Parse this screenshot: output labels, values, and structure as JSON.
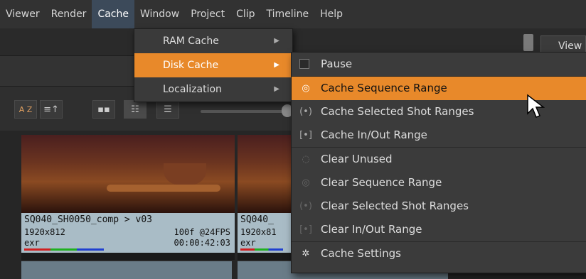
{
  "menubar": {
    "items": [
      "Viewer",
      "Render",
      "Cache",
      "Window",
      "Project",
      "Clip",
      "Timeline",
      "Help"
    ],
    "open_index": 2
  },
  "viewer_tab": {
    "label": "View"
  },
  "cache_menu": {
    "items": [
      {
        "label": "RAM Cache",
        "submenu": true
      },
      {
        "label": "Disk Cache",
        "submenu": true,
        "highlighted": true
      },
      {
        "label": "Localization",
        "submenu": true
      }
    ]
  },
  "disk_cache_menu": {
    "pause_label": "Pause",
    "items": [
      {
        "label": "Cache Sequence Range",
        "icon": "cache-sequence-icon",
        "highlighted": true
      },
      {
        "label": "Cache Selected Shot Ranges",
        "icon": "cache-selected-icon"
      },
      {
        "label": "Cache In/Out Range",
        "icon": "cache-inout-icon"
      },
      {
        "label": "Clear Unused",
        "icon": "clear-unused-icon"
      },
      {
        "label": "Clear Sequence Range",
        "icon": "clear-sequence-icon"
      },
      {
        "label": "Clear Selected Shot Ranges",
        "icon": "clear-selected-icon"
      },
      {
        "label": "Clear In/Out Range",
        "icon": "clear-inout-icon"
      },
      {
        "label": "Cache Settings",
        "icon": "gear-icon"
      }
    ],
    "highlight_color": "#e8892a"
  },
  "bin_toolbar": {
    "sort_label": "A Z"
  },
  "thumbnails": [
    {
      "name": "SQ040_SH0050_comp > v03",
      "resolution": "1920x812",
      "frames": "100f @24FPS",
      "format": "exr",
      "timecode": "00:00:42:03"
    },
    {
      "name": "SQ040_",
      "resolution": "1920x81",
      "frames": "",
      "format": "exr",
      "timecode": ""
    }
  ]
}
